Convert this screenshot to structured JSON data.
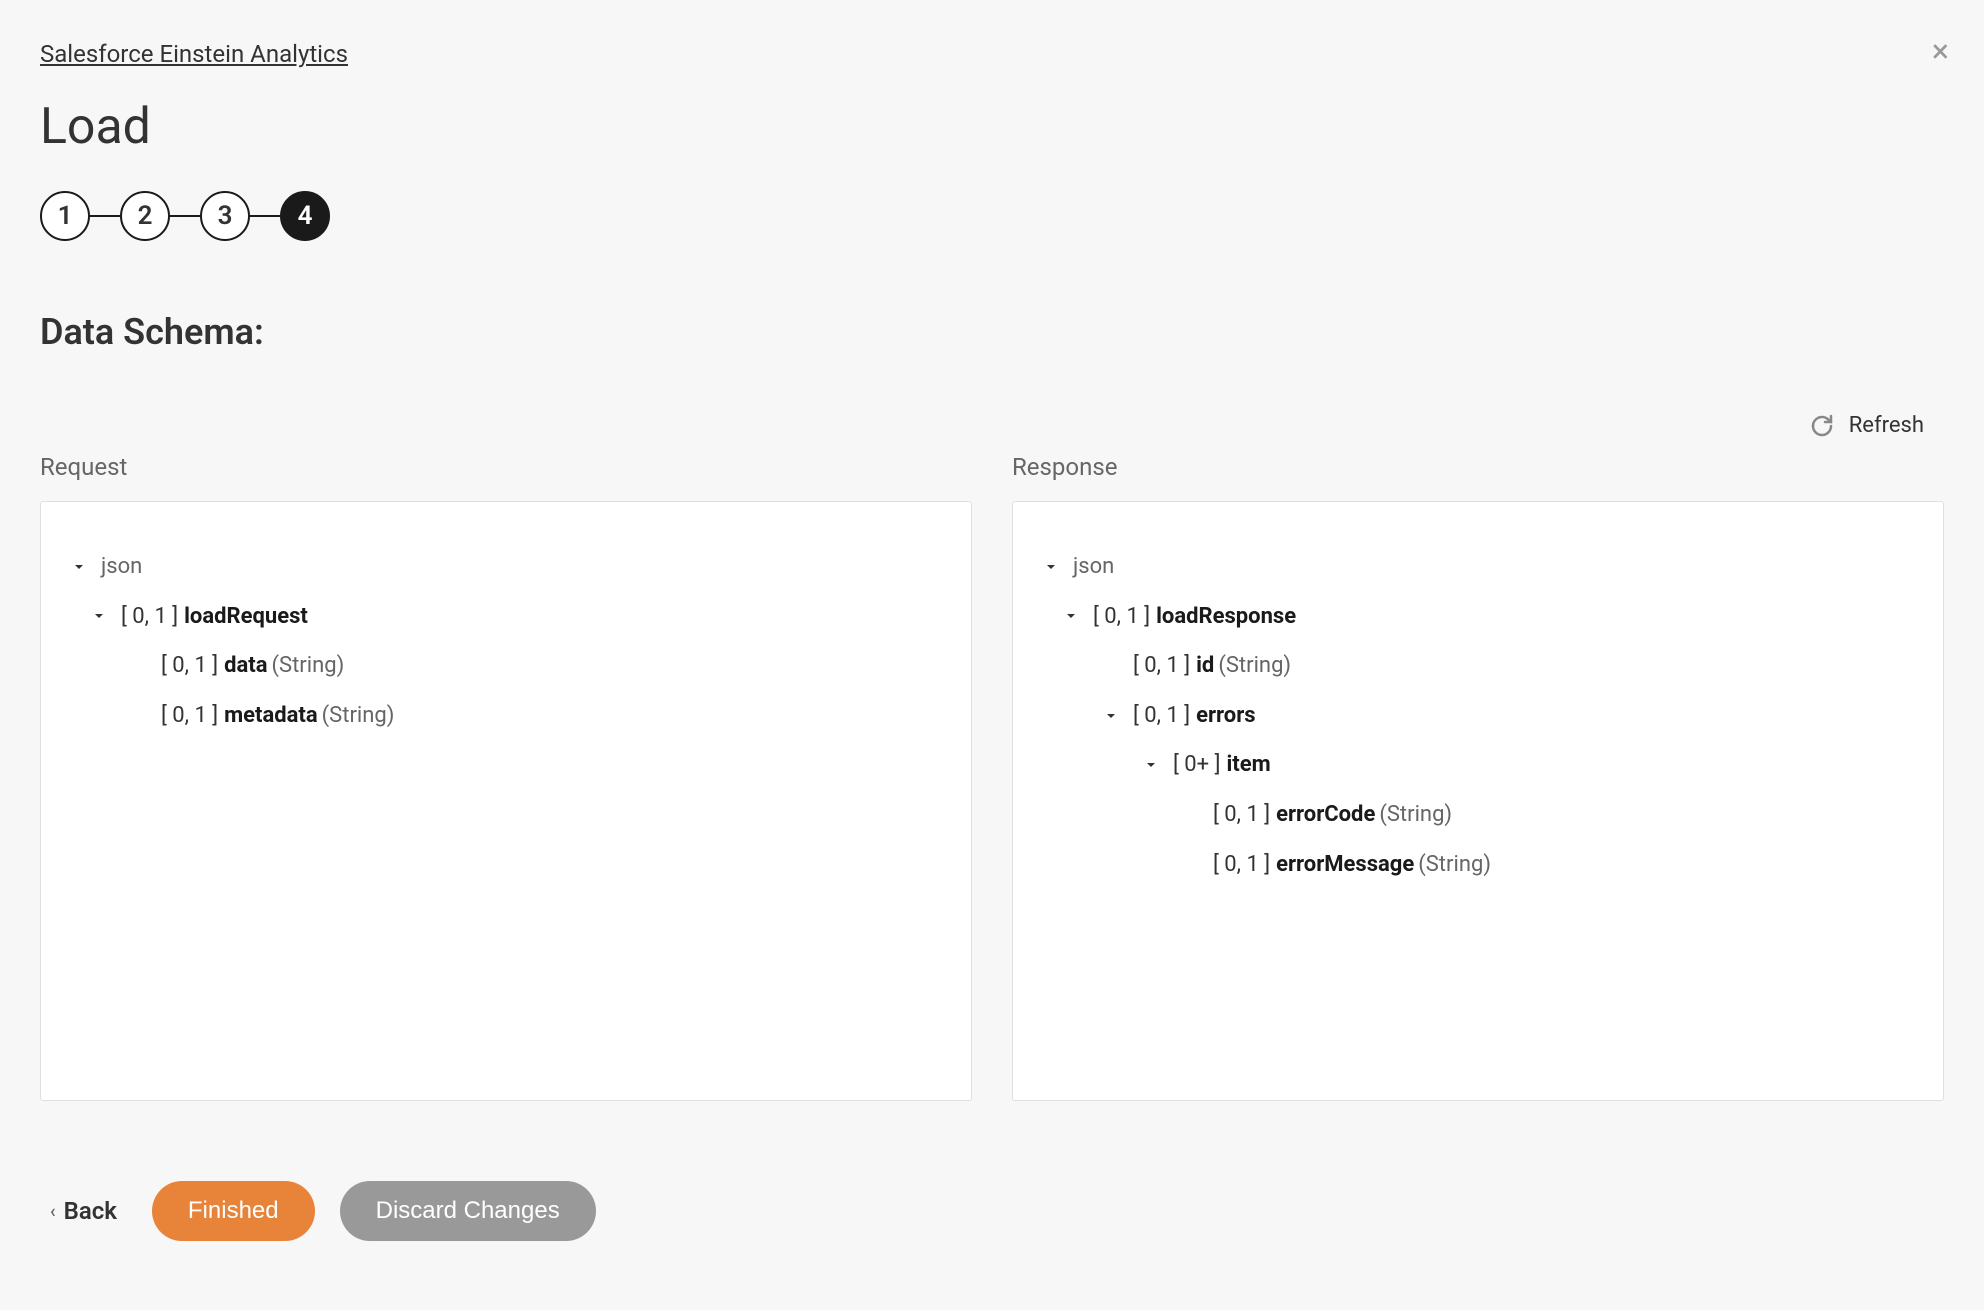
{
  "breadcrumb": "Salesforce Einstein Analytics",
  "page_title": "Load",
  "stepper": {
    "steps": [
      "1",
      "2",
      "3",
      "4"
    ],
    "active_index": 3
  },
  "section_title": "Data Schema:",
  "refresh_label": "Refresh",
  "schema": {
    "request": {
      "label": "Request",
      "root": "json",
      "tree": [
        {
          "indent": 1,
          "expandable": true,
          "cardinality": "[ 0, 1 ]",
          "name": "loadRequest",
          "type": ""
        },
        {
          "indent": 2,
          "expandable": false,
          "cardinality": "[ 0, 1 ]",
          "name": "data",
          "type": "(String)"
        },
        {
          "indent": 2,
          "expandable": false,
          "cardinality": "[ 0, 1 ]",
          "name": "metadata",
          "type": "(String)"
        }
      ]
    },
    "response": {
      "label": "Response",
      "root": "json",
      "tree": [
        {
          "indent": 1,
          "expandable": true,
          "cardinality": "[ 0, 1 ]",
          "name": "loadResponse",
          "type": ""
        },
        {
          "indent": 2,
          "expandable": false,
          "cardinality": "[ 0, 1 ]",
          "name": "id",
          "type": "(String)"
        },
        {
          "indent": 2,
          "expandable": true,
          "cardinality": "[ 0, 1 ]",
          "name": "errors",
          "type": ""
        },
        {
          "indent": 3,
          "expandable": true,
          "cardinality": "[ 0+ ]",
          "name": "item",
          "type": ""
        },
        {
          "indent": 4,
          "expandable": false,
          "cardinality": "[ 0, 1 ]",
          "name": "errorCode",
          "type": "(String)"
        },
        {
          "indent": 4,
          "expandable": false,
          "cardinality": "[ 0, 1 ]",
          "name": "errorMessage",
          "type": "(String)"
        }
      ]
    }
  },
  "footer": {
    "back_label": "Back",
    "finished_label": "Finished",
    "discard_label": "Discard Changes"
  }
}
